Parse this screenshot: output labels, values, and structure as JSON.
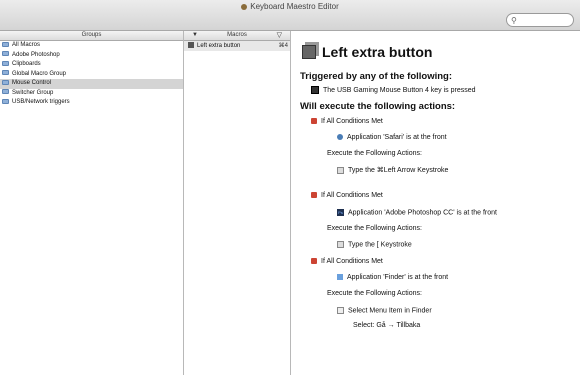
{
  "window": {
    "title": "Keyboard Maestro Editor",
    "search_placeholder": ""
  },
  "groups_header": "Groups",
  "groups": [
    "All Macros",
    "Adobe Photoshop",
    "Clipboards",
    "Global Macro Group",
    "Mouse Control",
    "Switcher Group",
    "USB/Network triggers"
  ],
  "selected_group": "Mouse Control",
  "macros_header": "Macros",
  "macros": [
    {
      "name": "Left extra button",
      "shortcut": "⌘4"
    }
  ],
  "editor": {
    "macro_name": "Left extra button",
    "triggered_heading": "Triggered by any of the following:",
    "trigger": "The USB Gaming Mouse Button 4 key is pressed",
    "actions_heading": "Will execute the following actions:",
    "blocks": [
      {
        "if": "If All Conditions Met",
        "condition": "Application 'Safari' is at the front",
        "execute": "Execute the Following Actions:",
        "action": "Type the ⌘Left Arrow Keystroke"
      },
      {
        "if": "If All Conditions Met",
        "condition": "Application 'Adobe Photoshop CC' is at the front",
        "execute": "Execute the Following Actions:",
        "action": "Type the [ Keystroke"
      },
      {
        "if": "If All Conditions Met",
        "condition": "Application 'Finder' is at the front",
        "execute": "Execute the Following Actions:",
        "action": "Select Menu Item in Finder",
        "detail": "Select: Gå → Tillbaka"
      }
    ]
  }
}
